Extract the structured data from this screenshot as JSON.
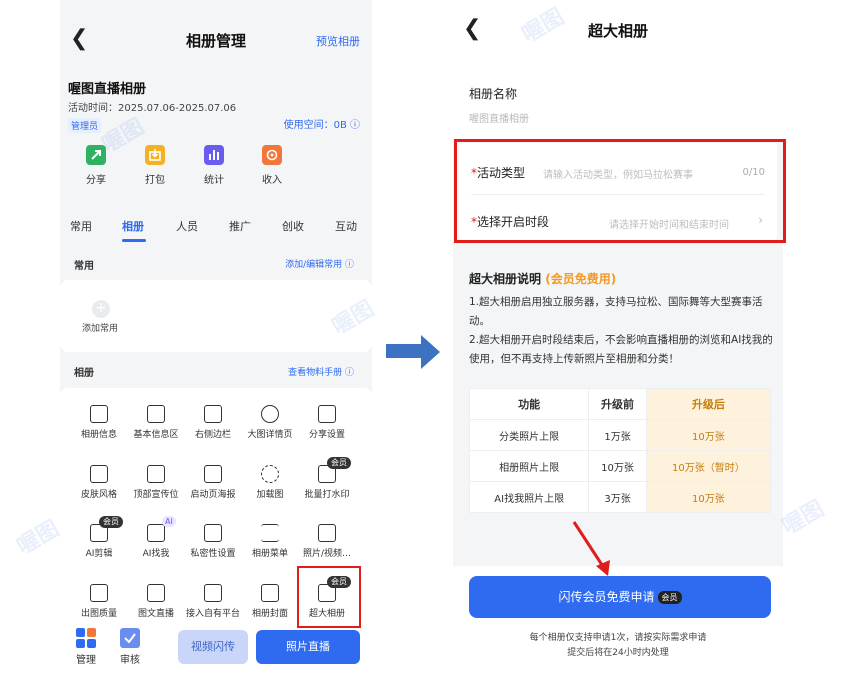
{
  "left": {
    "nav": {
      "back_icon": "chevron-left",
      "title": "相册管理",
      "preview_link": "预览相册"
    },
    "album": {
      "name": "喔图直播相册",
      "time": "活动时间：2025.07.06-2025.07.06",
      "admin_badge": "管理员",
      "storage": "使用空间：0B ⓘ"
    },
    "quick_actions": [
      {
        "label": "分享",
        "icon": "share-icon",
        "color": "#2fb163"
      },
      {
        "label": "打包",
        "icon": "package-icon",
        "color": "#f2b221"
      },
      {
        "label": "统计",
        "icon": "stats-icon",
        "color": "#6a5cf0"
      },
      {
        "label": "收入",
        "icon": "income-icon",
        "color": "#f2773a"
      }
    ],
    "tabs": [
      "常用",
      "相册",
      "人员",
      "推广",
      "创收",
      "互动"
    ],
    "active_tab": "相册",
    "common_section": {
      "title": "常用",
      "link": "添加/编辑常用 ⓘ",
      "add_label": "添加常用"
    },
    "album_section": {
      "title": "相册",
      "link": "查看物料手册 ⓘ"
    },
    "grid": [
      {
        "label": "相册信息",
        "icon": "doc-edit-icon"
      },
      {
        "label": "基本信息区",
        "icon": "doc-list-icon"
      },
      {
        "label": "右侧边栏",
        "icon": "sidebar-icon"
      },
      {
        "label": "大图详情页",
        "icon": "info-icon"
      },
      {
        "label": "分享设置",
        "icon": "share-settings-icon"
      },
      {
        "label": "皮肤风格",
        "icon": "shirt-icon"
      },
      {
        "label": "顶部宣传位",
        "icon": "banner-icon"
      },
      {
        "label": "启动页海报",
        "icon": "poster-icon"
      },
      {
        "label": "加载图",
        "icon": "loading-icon"
      },
      {
        "label": "批量打水印",
        "icon": "watermark-icon",
        "badge": "会员"
      },
      {
        "label": "AI剪辑",
        "icon": "scissors-icon",
        "badge": "会员"
      },
      {
        "label": "AI找我",
        "icon": "face-search-icon",
        "badge_ai": "AI"
      },
      {
        "label": "私密性设置",
        "icon": "lock-icon"
      },
      {
        "label": "相册菜单",
        "icon": "menu-icon"
      },
      {
        "label": "照片/视频…",
        "icon": "media-icon"
      },
      {
        "label": "出图质量",
        "icon": "hd-icon"
      },
      {
        "label": "图文直播",
        "icon": "image-text-icon"
      },
      {
        "label": "接入自有平台",
        "icon": "platform-icon"
      },
      {
        "label": "相册封面",
        "icon": "cover-icon"
      },
      {
        "label": "超大相册",
        "icon": "big-album-icon",
        "badge": "会员"
      }
    ],
    "bottom": {
      "manage": "管理",
      "review": "审核",
      "flash_button": "视频闪传",
      "live_button": "照片直播"
    }
  },
  "right": {
    "nav": {
      "back_icon": "chevron-left",
      "title": "超大相册"
    },
    "name_label": "相册名称",
    "name_value": "喔图直播相册",
    "form": {
      "type_label": "活动类型",
      "type_placeholder": "请输入活动类型，例如马拉松赛事",
      "type_count": "0/10",
      "time_label": "选择开启时段",
      "time_placeholder": "请选择开始时间和结束时间",
      "required_mark": "*"
    },
    "info": {
      "title": "超大相册说明",
      "vip_free": "(会员免费用)",
      "text1": "1.超大相册启用独立服务器，支持马拉松、国际舞等大型赛事活动。",
      "text2": "2.超大相册开启时段结束后，不会影响直播相册的浏览和AI找我的使用，但不再支持上传新照片至相册和分类！"
    },
    "table": {
      "headers": [
        "功能",
        "升级前",
        "升级后"
      ],
      "rows": [
        [
          "分类照片上限",
          "1万张",
          "10万张"
        ],
        [
          "相册照片上限",
          "10万张",
          "10万张（暂时）"
        ],
        [
          "AI找我照片上限",
          "3万张",
          "10万张"
        ]
      ]
    },
    "apply_button": "闪传会员免费申请",
    "apply_badge": "会员",
    "note1": "每个相册仅支持申请1次，请按实际需求申请",
    "note2": "提交后将在24小时内处理"
  },
  "colors": {
    "accent": "#2f6bf0",
    "highlight": "#e21b1b",
    "vip_orange": "#f29b24"
  },
  "watermark_text": "喔图"
}
